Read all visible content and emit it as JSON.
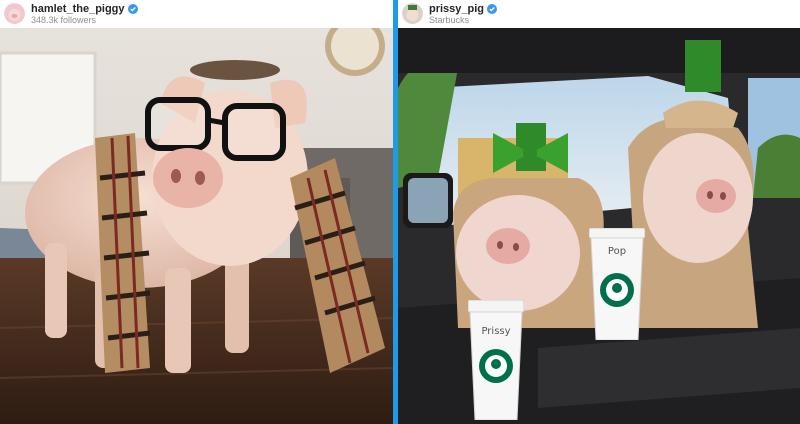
{
  "posts": [
    {
      "username": "hamlet_the_piggy",
      "subtitle": "348.3k followers",
      "verified": true,
      "photo_icon": "photo-pig-glasses-scarf"
    },
    {
      "username": "prissy_pig",
      "subtitle": "Starbucks",
      "verified": true,
      "photo_icon": "photo-pigs-car-starbucks",
      "cups": [
        {
          "label": "Pop"
        },
        {
          "label": "Prissy"
        }
      ]
    }
  ],
  "colors": {
    "divider": "#1e9be8",
    "verified": "#3897f0",
    "starbucks_green": "#00704a"
  }
}
